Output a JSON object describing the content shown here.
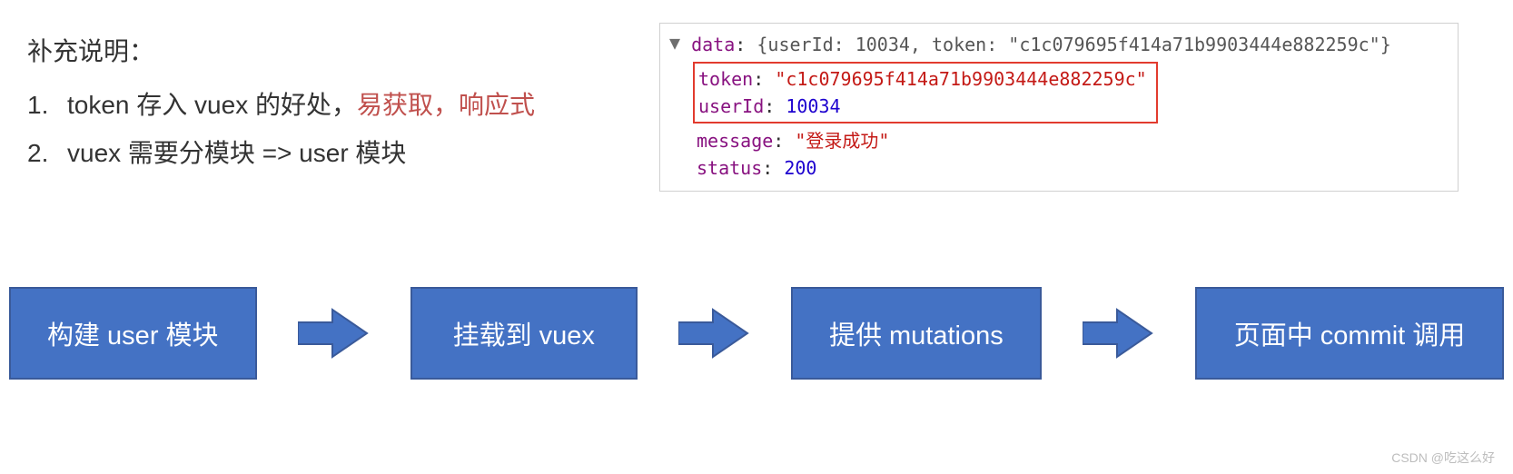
{
  "notes": {
    "heading": "补充说明：",
    "items": [
      {
        "num": "1.",
        "text_before": "token 存入 vuex 的好处，",
        "highlight": "易获取，响应式"
      },
      {
        "num": "2.",
        "text_before": "vuex 需要分模块 => user 模块",
        "highlight": ""
      }
    ]
  },
  "devtools": {
    "summary_key": "data",
    "summary_inline": "{userId: 10034, token: \"c1c079695f414a71b9903444e882259c\"}",
    "boxed": {
      "token_key": "token",
      "token_val": "\"c1c079695f414a71b9903444e882259c\"",
      "userId_key": "userId",
      "userId_val": "10034"
    },
    "message_key": "message",
    "message_val": "\"登录成功\"",
    "status_key": "status",
    "status_val": "200"
  },
  "flow": {
    "steps": [
      "构建 user 模块",
      "挂载到 vuex",
      "提供 mutations",
      "页面中 commit 调用"
    ]
  },
  "watermark": "CSDN @吃这么好"
}
